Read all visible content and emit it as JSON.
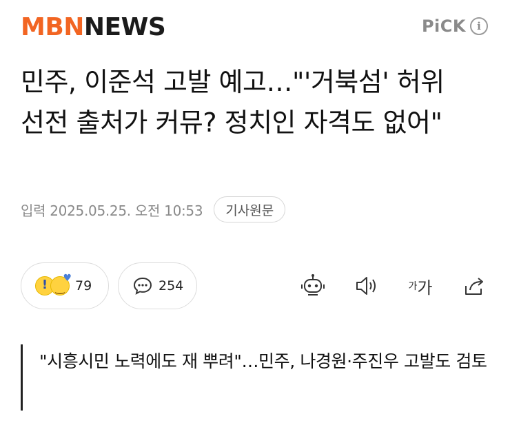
{
  "header": {
    "logo_mbn": "MBN",
    "logo_news": "NEWS",
    "pick_label": "PiCK",
    "info_glyph": "i"
  },
  "article": {
    "headline": "민주, 이준석 고발 예고…\"'거북섬' 허위 선전 출처가 커뮤? 정치인 자격도 없어\"",
    "published": "입력 2025.05.25. 오전 10:53",
    "source_button": "기사원문"
  },
  "actions": {
    "reaction_count": "79",
    "comment_count": "254",
    "font_small": "가",
    "font_large": "가",
    "icons": [
      "surprise-emoji",
      "love-emoji",
      "comment-icon",
      "bot-icon",
      "speaker-icon",
      "font-size-icon",
      "share-icon"
    ]
  },
  "related": {
    "title": "\"시흥시민 노력에도 재 뿌려\"…민주, 나경원·주진우 고발도 검토"
  },
  "colors": {
    "brand_orange": "#f26522",
    "text_dark": "#111111",
    "muted_gray": "#8a8a8a",
    "border_gray": "#dcdcdc"
  }
}
